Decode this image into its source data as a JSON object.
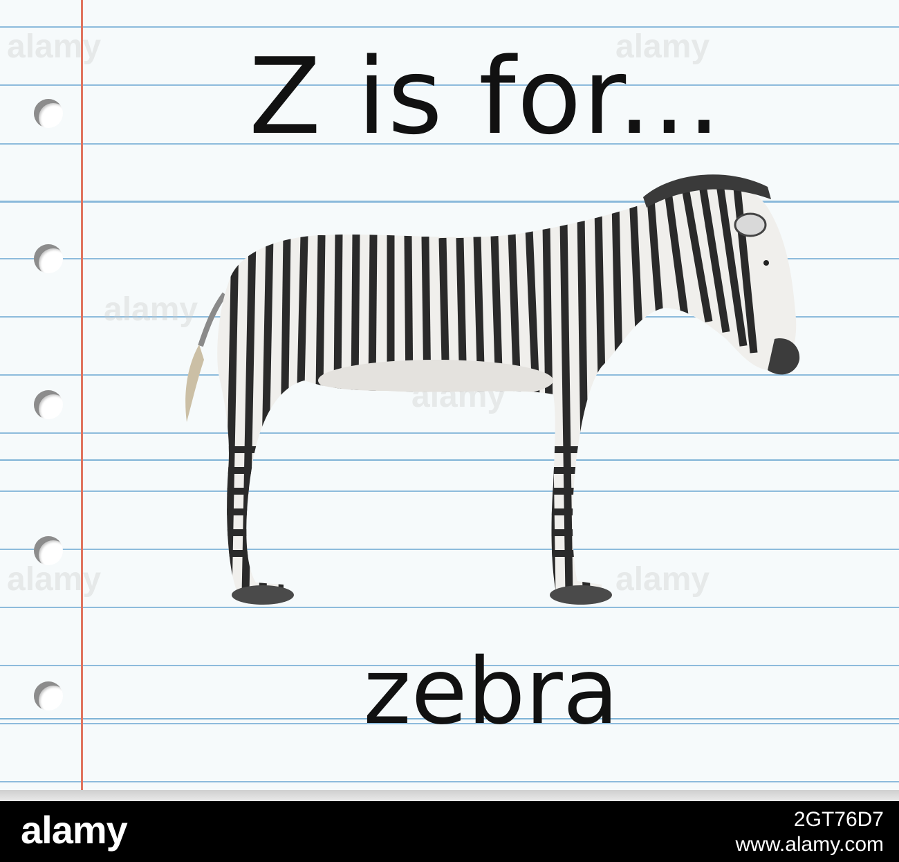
{
  "flashcard": {
    "heading": "Z is for...",
    "word": "zebra"
  },
  "illustration": {
    "subject": "zebra"
  },
  "watermark": {
    "logo": "alamy",
    "image_id": "2GT76D7",
    "url": "www.alamy.com",
    "overlay_text": "alamy"
  },
  "colors": {
    "paper": "#f6fafb",
    "rule_line": "#8dbbdc",
    "margin_line": "#e0745f",
    "ink": "#111111",
    "footer_bar": "#000000"
  }
}
